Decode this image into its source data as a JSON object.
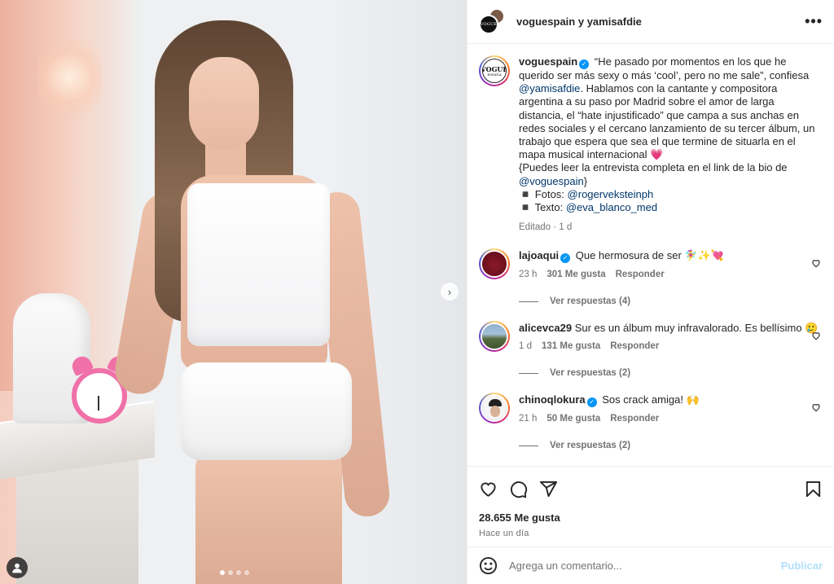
{
  "header": {
    "title": "voguespain y yamisafdie",
    "vogue_mark": "VOGUE"
  },
  "caption": {
    "username": "voguespain",
    "vogue_mark": "VOGUE",
    "vogue_sub": "ESPAÑA",
    "text_1": " “He pasado por momentos en los que he querido ser más sexy o más ‘cool’, pero no me sale”, confiesa ",
    "mention_1": "@yamisafdie",
    "text_2": ". Hablamos con la cantante y compositora argentina a su paso por Madrid sobre el amor de larga distancia, el “hate injustificado” que campa a sus anchas en redes sociales y el cercano lanzamiento de su tercer álbum, un trabajo que espera que sea el que termine de situarla en el mapa musical internacional 💗",
    "text_3": "{Puedes leer la entrevista completa en el link de la bio de ",
    "mention_2": "@voguespain",
    "text_4": "}",
    "fotos_label": "◾️ Fotos: ",
    "fotos_mention": "@rogerveksteinph",
    "texto_label": "◾️ Texto: ",
    "texto_mention": "@eva_blanco_med",
    "meta": "Editado · 1 d"
  },
  "comments": [
    {
      "username": "lajoaqui",
      "text": "Que hermosura de ser 🧚‍♀️✨💘",
      "time": "23 h",
      "likes": "301 Me gusta",
      "reply": "Responder",
      "view_replies": "Ver respuestas (4)"
    },
    {
      "username": "alicevca29",
      "text": "Sur es un álbum muy infravalorado. Es bellísimo 🥲",
      "time": "1 d",
      "likes": "131 Me gusta",
      "reply": "Responder",
      "view_replies": "Ver respuestas (2)"
    },
    {
      "username": "chinoqlokura",
      "text": "Sos crack amiga! 🙌",
      "time": "21 h",
      "likes": "50 Me gusta",
      "reply": "Responder",
      "view_replies": "Ver respuestas (2)"
    }
  ],
  "post": {
    "likes": "28.655 Me gusta",
    "when": "Hace un día"
  },
  "composer": {
    "placeholder": "Agrega un comentario...",
    "publish": "Publicar"
  },
  "carousel": {
    "next_glyph": "›",
    "current_slide": 1,
    "total_slides": 4
  },
  "icons": [
    "more-options-icon",
    "verified-badge-icon",
    "heart-icon",
    "comment-icon",
    "share-icon",
    "save-icon",
    "emoji-icon",
    "tagged-user-icon",
    "chevron-right-icon"
  ],
  "colors": {
    "verified": "#0095f6",
    "link": "#00376b",
    "secondary_text": "#737373",
    "publish_disabled": "#b2dffc"
  }
}
